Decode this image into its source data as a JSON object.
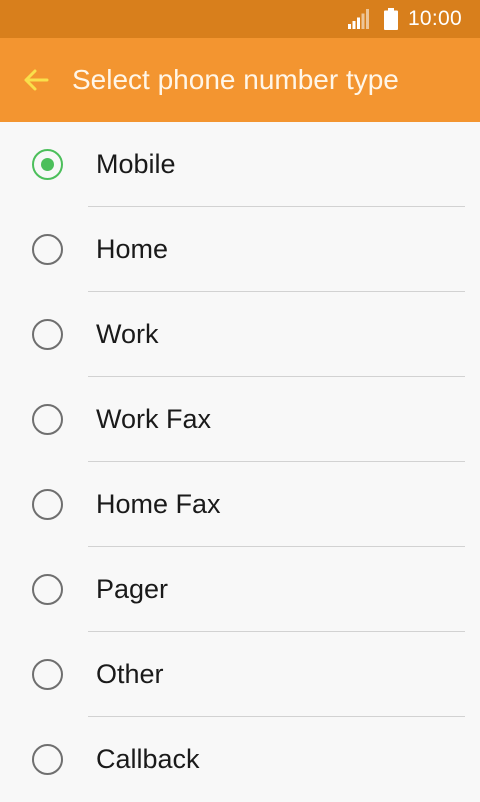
{
  "status_bar": {
    "time": "10:00",
    "icons": [
      "signal-icon",
      "battery-icon"
    ]
  },
  "app_bar": {
    "title": "Select phone number type",
    "back_icon": "back-arrow-icon",
    "back_icon_color": "#f9e04b"
  },
  "colors": {
    "status_bar": "#d87f1c",
    "app_bar": "#f39530",
    "background": "#f8f8f8",
    "radio_selected": "#4cbf5b",
    "radio_unselected": "#6f6f6f"
  },
  "options": [
    {
      "label": "Mobile",
      "selected": true
    },
    {
      "label": "Home",
      "selected": false
    },
    {
      "label": "Work",
      "selected": false
    },
    {
      "label": "Work Fax",
      "selected": false
    },
    {
      "label": "Home Fax",
      "selected": false
    },
    {
      "label": "Pager",
      "selected": false
    },
    {
      "label": "Other",
      "selected": false
    },
    {
      "label": "Callback",
      "selected": false
    }
  ]
}
